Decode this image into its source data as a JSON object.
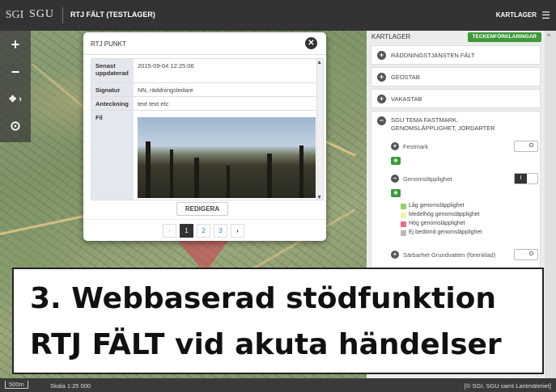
{
  "header": {
    "logo_mark": "SGI",
    "logo_text": "SGU",
    "app_title": "RTJ FÄLT (TESTLAGER)",
    "layers_label": "KARTLAGER",
    "menu_icon": "hamburger-icon"
  },
  "map_controls": {
    "zoom_in": "+",
    "zoom_out": "−",
    "pan": "✥ ›",
    "locate": "⊙"
  },
  "popup": {
    "title": "RTJ PUNKT",
    "close": "✕",
    "rows": [
      {
        "key": "Senast uppdaterad",
        "value": "2015-09-04 12:25:06"
      },
      {
        "key": "Signatur",
        "value": "NN, räddningsledare"
      },
      {
        "key": "Anteckning",
        "value": "text text etc"
      },
      {
        "key": "Fil",
        "value": ""
      }
    ],
    "edit_label": "REDIGERA",
    "pager": {
      "prev": "‹",
      "pages": [
        "1",
        "2",
        "3"
      ],
      "current": "1",
      "next": "›"
    }
  },
  "panel": {
    "title": "KARTLAGER",
    "legend_button": "TECKENFÖRKLARINGAR",
    "layers": [
      {
        "label": "RÄDDNINGSTJÄNSTEN FÄLT",
        "icon": "+"
      },
      {
        "label": "GEOSTAB",
        "icon": "+"
      },
      {
        "label": "VAKASTAB",
        "icon": "+"
      },
      {
        "label": "SGU TEMA FASTMARK, GENOMSLÄPPLIGHET, JORDARTER",
        "icon": "−"
      }
    ],
    "sublayers": [
      {
        "label": "Festmark",
        "toggle": "O",
        "state": "off",
        "icon": "+"
      },
      {
        "label": "Genomsläpplighet",
        "toggle": "I",
        "state": "on",
        "icon": "−"
      },
      {
        "label": "Särbarhet Grundvatten (förenklad)",
        "toggle": "O",
        "state": "off",
        "icon": "+"
      }
    ],
    "legend": [
      {
        "label": "Låg genomsläpplighet",
        "color": "#8fd16b"
      },
      {
        "label": "Medelhög genomsläpplighet",
        "color": "#f6f2a6"
      },
      {
        "label": "Hög genomsläpplighet",
        "color": "#e46f86"
      },
      {
        "label": "Ej bedömd genomsläpplighet",
        "color": "#b9b9b9"
      }
    ]
  },
  "caption": {
    "line1": "3. Webbaserad stödfunktion",
    "line2": "RTJ FÄLT vid akuta händelser"
  },
  "footer": {
    "scale_bar": "500m",
    "scale_text": "Skala 1:25 000",
    "attribution": "[© SGI, SGU samt Lantmäteriet]"
  },
  "colors": {
    "topbar": "#333333",
    "accent_green": "#3f9a3c",
    "zone_red": "#d23c50"
  }
}
